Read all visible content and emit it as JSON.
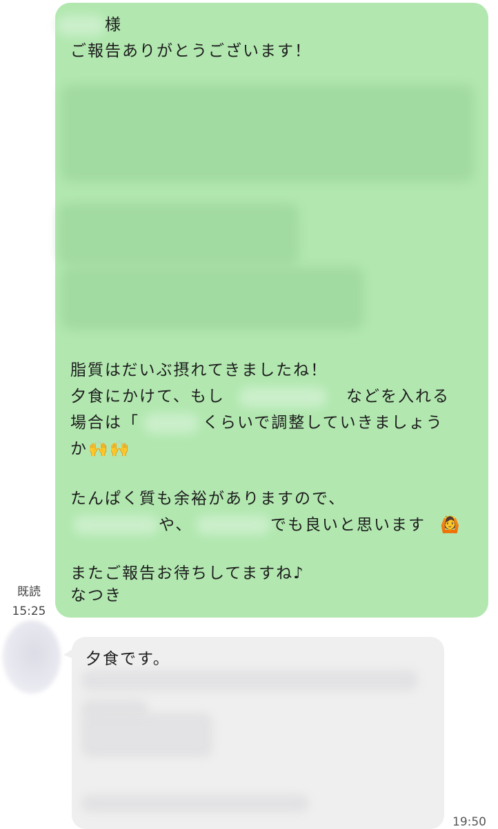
{
  "outgoing": {
    "salutation": "様",
    "line1": "ご報告ありがとうございます！",
    "para1": "脂質はだいぶ摂れてきましたね！",
    "para2_a": "夕食にかけて、もし",
    "para2_b": "などを入れる",
    "para3_a": "場合は「",
    "para3_b": "くらいで調整していきましょう",
    "para4": "か",
    "para4_emoji": "🙌🙌",
    "para5": "たんぱく質も余裕がありますので、",
    "para6_a": "や、",
    "para6_b": "でも良いと思います",
    "para6_emoji": "🙆",
    "para7": "またご報告お待ちしてますね♪",
    "signature": "なつき"
  },
  "read_status": {
    "label": "既読",
    "time": "15:25"
  },
  "incoming": {
    "text": "夕食です。",
    "time": "19:50"
  },
  "colors": {
    "outgoing_bubble": "#b2e8b0",
    "incoming_bubble": "#efefef",
    "background": "#ffffff"
  }
}
